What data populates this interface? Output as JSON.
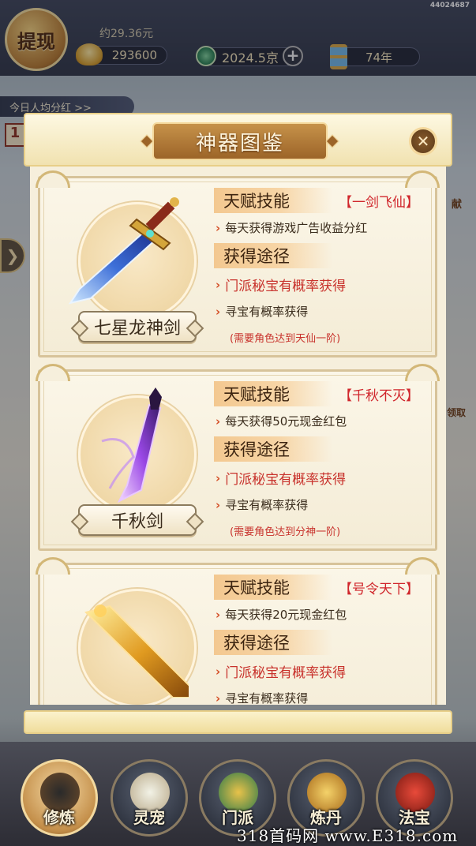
{
  "top": {
    "withdraw_label": "提现",
    "approx_text": "约29.36元",
    "money_value": "293600",
    "jing_value": "2024.5京",
    "plus_label": "+",
    "year_value": "74年",
    "screenshot_id": "44024687"
  },
  "background": {
    "dividend_text": "今日人均分红 >>",
    "badge": "1",
    "side_text_1": "献",
    "side_text_2": "领取"
  },
  "modal": {
    "title": "神器图鉴",
    "close_label": "✕",
    "cards": [
      {
        "name": "七星龙神剑",
        "talent_header": "天赋技能",
        "skill_name": "【一剑飞仙】",
        "talent_desc": "每天获得游戏广告收益分红",
        "obtain_header": "获得途径",
        "way1": "门派秘宝有概率获得",
        "way2": "寻宝有概率获得",
        "requirement": "(需要角色达到天仙一阶)"
      },
      {
        "name": "千秋剑",
        "talent_header": "天赋技能",
        "skill_name": "【千秋不灭】",
        "talent_desc": "每天获得50元现金红包",
        "obtain_header": "获得途径",
        "way1": "门派秘宝有概率获得",
        "way2": "寻宝有概率获得",
        "requirement": "(需要角色达到分神一阶)"
      },
      {
        "name": "",
        "talent_header": "天赋技能",
        "skill_name": "【号令天下】",
        "talent_desc": "每天获得20元现金红包",
        "obtain_header": "获得途径",
        "way1": "门派秘宝有概率获得",
        "way2": "寻宝有概率获得",
        "requirement": ""
      }
    ]
  },
  "nav": {
    "items": [
      {
        "label": "修炼",
        "icon": "cultivator-portrait-icon"
      },
      {
        "label": "灵宠",
        "icon": "spirit-pet-icon"
      },
      {
        "label": "门派",
        "icon": "sect-building-icon"
      },
      {
        "label": "炼丹",
        "icon": "alchemy-gourd-icon"
      },
      {
        "label": "法宝",
        "icon": "treasure-box-icon"
      }
    ]
  },
  "watermark": "318首码网 www.E318.com",
  "colors": {
    "accent_red": "#c8322c",
    "banner_brown": "#9c6428",
    "gold": "#f4d89c"
  }
}
